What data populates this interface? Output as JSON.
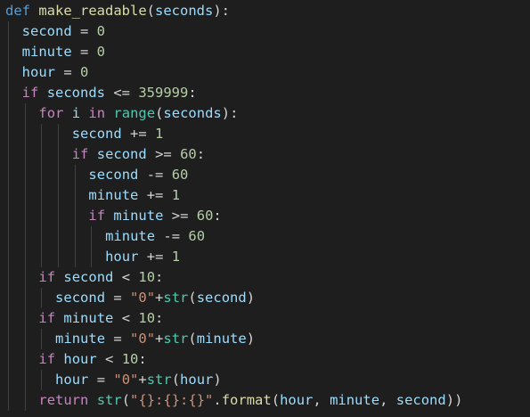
{
  "editor": {
    "background": "#1e1e1e",
    "language": "python",
    "lines": [
      {
        "indent": 0,
        "tokens": [
          {
            "t": "def",
            "c": "kw"
          },
          {
            "t": " ",
            "c": "op"
          },
          {
            "t": "make_readable",
            "c": "fn"
          },
          {
            "t": "(",
            "c": "op"
          },
          {
            "t": "seconds",
            "c": "var"
          },
          {
            "t": "):",
            "c": "op"
          }
        ]
      },
      {
        "indent": 1,
        "tokens": [
          {
            "t": "second",
            "c": "var"
          },
          {
            "t": " = ",
            "c": "op"
          },
          {
            "t": "0",
            "c": "num"
          }
        ]
      },
      {
        "indent": 1,
        "tokens": [
          {
            "t": "minute",
            "c": "var"
          },
          {
            "t": " = ",
            "c": "op"
          },
          {
            "t": "0",
            "c": "num"
          }
        ]
      },
      {
        "indent": 1,
        "tokens": [
          {
            "t": "hour",
            "c": "var"
          },
          {
            "t": " = ",
            "c": "op"
          },
          {
            "t": "0",
            "c": "num"
          }
        ]
      },
      {
        "indent": 1,
        "tokens": [
          {
            "t": "if",
            "c": "ctl"
          },
          {
            "t": " ",
            "c": "op"
          },
          {
            "t": "seconds",
            "c": "var"
          },
          {
            "t": " <= ",
            "c": "op"
          },
          {
            "t": "359999",
            "c": "num"
          },
          {
            "t": ":",
            "c": "op"
          }
        ]
      },
      {
        "indent": 2,
        "tokens": [
          {
            "t": "for",
            "c": "ctl"
          },
          {
            "t": " ",
            "c": "op"
          },
          {
            "t": "i",
            "c": "var"
          },
          {
            "t": " ",
            "c": "op"
          },
          {
            "t": "in",
            "c": "ctl"
          },
          {
            "t": " ",
            "c": "op"
          },
          {
            "t": "range",
            "c": "bi"
          },
          {
            "t": "(",
            "c": "op"
          },
          {
            "t": "seconds",
            "c": "var"
          },
          {
            "t": "):",
            "c": "op"
          }
        ]
      },
      {
        "indent": 4,
        "tokens": [
          {
            "t": "second",
            "c": "var"
          },
          {
            "t": " += ",
            "c": "op"
          },
          {
            "t": "1",
            "c": "num"
          }
        ]
      },
      {
        "indent": 4,
        "tokens": [
          {
            "t": "if",
            "c": "ctl"
          },
          {
            "t": " ",
            "c": "op"
          },
          {
            "t": "second",
            "c": "var"
          },
          {
            "t": " >= ",
            "c": "op"
          },
          {
            "t": "60",
            "c": "num"
          },
          {
            "t": ":",
            "c": "op"
          }
        ]
      },
      {
        "indent": 5,
        "tokens": [
          {
            "t": "second",
            "c": "var"
          },
          {
            "t": " -= ",
            "c": "op"
          },
          {
            "t": "60",
            "c": "num"
          }
        ]
      },
      {
        "indent": 5,
        "tokens": [
          {
            "t": "minute",
            "c": "var"
          },
          {
            "t": " += ",
            "c": "op"
          },
          {
            "t": "1",
            "c": "num"
          }
        ]
      },
      {
        "indent": 5,
        "tokens": [
          {
            "t": "if",
            "c": "ctl"
          },
          {
            "t": " ",
            "c": "op"
          },
          {
            "t": "minute",
            "c": "var"
          },
          {
            "t": " >= ",
            "c": "op"
          },
          {
            "t": "60",
            "c": "num"
          },
          {
            "t": ":",
            "c": "op"
          }
        ]
      },
      {
        "indent": 6,
        "tokens": [
          {
            "t": "minute",
            "c": "var"
          },
          {
            "t": " -= ",
            "c": "op"
          },
          {
            "t": "60",
            "c": "num"
          }
        ]
      },
      {
        "indent": 6,
        "tokens": [
          {
            "t": "hour",
            "c": "var"
          },
          {
            "t": " += ",
            "c": "op"
          },
          {
            "t": "1",
            "c": "num"
          }
        ]
      },
      {
        "indent": 2,
        "tokens": [
          {
            "t": "if",
            "c": "ctl"
          },
          {
            "t": " ",
            "c": "op"
          },
          {
            "t": "second",
            "c": "var"
          },
          {
            "t": " < ",
            "c": "op"
          },
          {
            "t": "10",
            "c": "num"
          },
          {
            "t": ":",
            "c": "op"
          }
        ]
      },
      {
        "indent": 3,
        "tokens": [
          {
            "t": "second",
            "c": "var"
          },
          {
            "t": " = ",
            "c": "op"
          },
          {
            "t": "\"0\"",
            "c": "str"
          },
          {
            "t": "+",
            "c": "op"
          },
          {
            "t": "str",
            "c": "bi"
          },
          {
            "t": "(",
            "c": "op"
          },
          {
            "t": "second",
            "c": "var"
          },
          {
            "t": ")",
            "c": "op"
          }
        ]
      },
      {
        "indent": 2,
        "tokens": [
          {
            "t": "if",
            "c": "ctl"
          },
          {
            "t": " ",
            "c": "op"
          },
          {
            "t": "minute",
            "c": "var"
          },
          {
            "t": " < ",
            "c": "op"
          },
          {
            "t": "10",
            "c": "num"
          },
          {
            "t": ":",
            "c": "op"
          }
        ]
      },
      {
        "indent": 3,
        "tokens": [
          {
            "t": "minute",
            "c": "var"
          },
          {
            "t": " = ",
            "c": "op"
          },
          {
            "t": "\"0\"",
            "c": "str"
          },
          {
            "t": "+",
            "c": "op"
          },
          {
            "t": "str",
            "c": "bi"
          },
          {
            "t": "(",
            "c": "op"
          },
          {
            "t": "minute",
            "c": "var"
          },
          {
            "t": ")",
            "c": "op"
          }
        ]
      },
      {
        "indent": 2,
        "tokens": [
          {
            "t": "if",
            "c": "ctl"
          },
          {
            "t": " ",
            "c": "op"
          },
          {
            "t": "hour",
            "c": "var"
          },
          {
            "t": " < ",
            "c": "op"
          },
          {
            "t": "10",
            "c": "num"
          },
          {
            "t": ":",
            "c": "op"
          }
        ]
      },
      {
        "indent": 3,
        "tokens": [
          {
            "t": "hour",
            "c": "var"
          },
          {
            "t": " = ",
            "c": "op"
          },
          {
            "t": "\"0\"",
            "c": "str"
          },
          {
            "t": "+",
            "c": "op"
          },
          {
            "t": "str",
            "c": "bi"
          },
          {
            "t": "(",
            "c": "op"
          },
          {
            "t": "hour",
            "c": "var"
          },
          {
            "t": ")",
            "c": "op"
          }
        ]
      },
      {
        "indent": 2,
        "tokens": [
          {
            "t": "return",
            "c": "ctl"
          },
          {
            "t": " ",
            "c": "op"
          },
          {
            "t": "str",
            "c": "bi"
          },
          {
            "t": "(",
            "c": "op"
          },
          {
            "t": "\"{}:{}:{}\"",
            "c": "str"
          },
          {
            "t": ".",
            "c": "op"
          },
          {
            "t": "format",
            "c": "fn"
          },
          {
            "t": "(",
            "c": "op"
          },
          {
            "t": "hour",
            "c": "var"
          },
          {
            "t": ", ",
            "c": "op"
          },
          {
            "t": "minute",
            "c": "var"
          },
          {
            "t": ", ",
            "c": "op"
          },
          {
            "t": "second",
            "c": "var"
          },
          {
            "t": "))",
            "c": "op"
          }
        ]
      }
    ]
  }
}
